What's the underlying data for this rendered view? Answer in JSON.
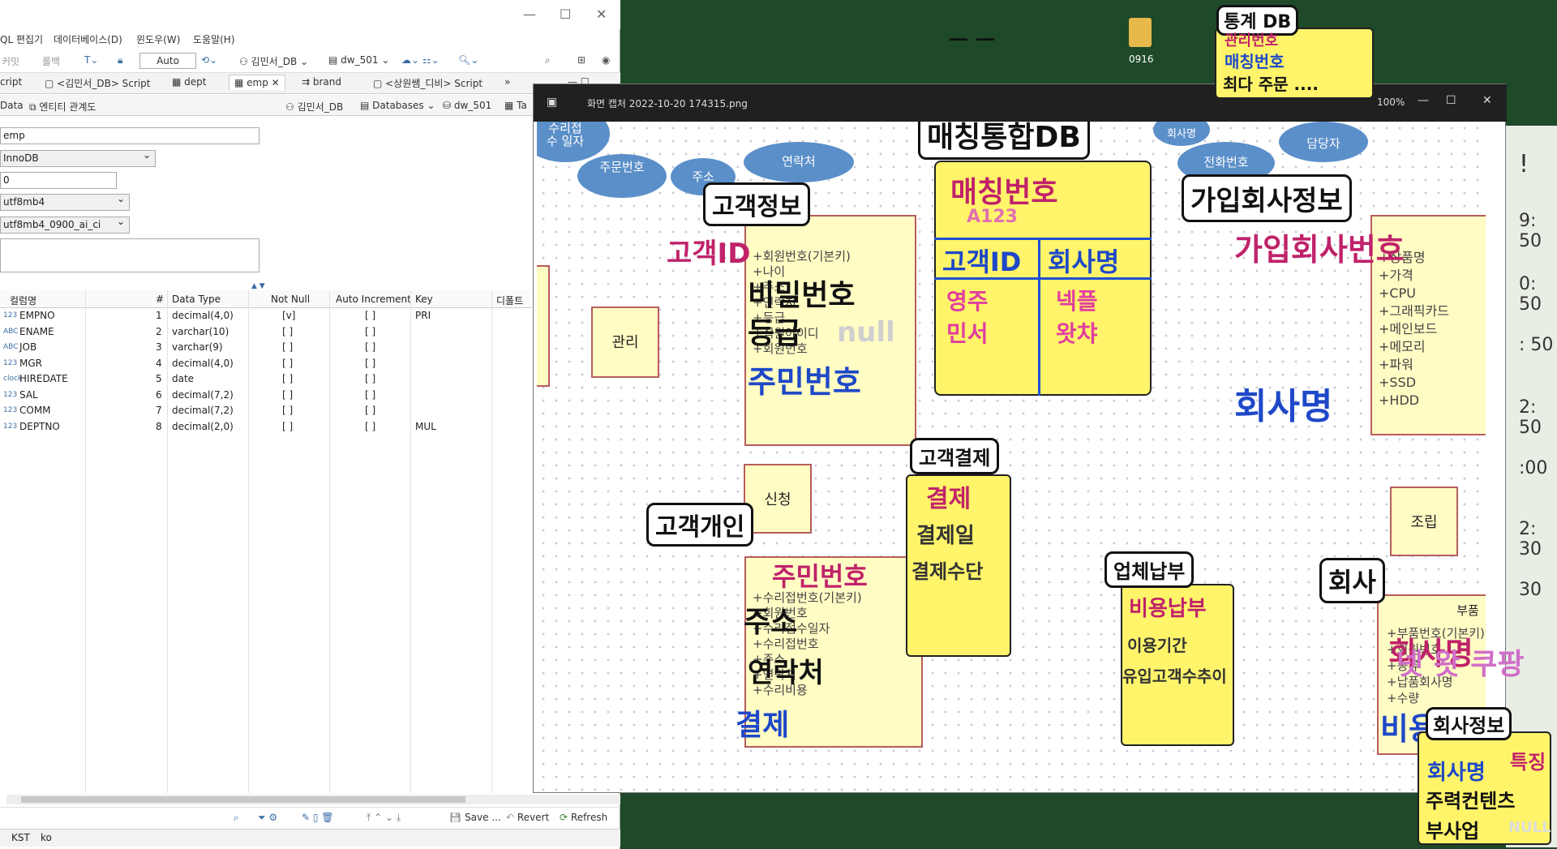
{
  "left_window": {
    "menu": [
      "QL 편집기",
      "데이터베이스(D)",
      "윈도우(W)",
      "도움말(H)"
    ],
    "toolbar": {
      "commit": "커밋",
      "rollback": "롤백",
      "auto": "Auto",
      "connection": "김민서_DB",
      "database": "dw_501"
    },
    "tabs": [
      "cript",
      "<김민서_DB> Script",
      "dept",
      "emp",
      "brand",
      "<상원쌤_디비> Script"
    ],
    "subtabs": [
      "Data",
      "엔티티 관계도",
      "김민서_DB",
      "Databases",
      "dw_501",
      "Ta"
    ],
    "props": {
      "name": "emp",
      "engine": "InnoDB",
      "auto_increment": "0",
      "charset": "utf8mb4",
      "collation": "utf8mb4_0900_ai_ci"
    },
    "columns_header": [
      "컬럼명",
      "#",
      "Data Type",
      "Not Null",
      "Auto Increment",
      "Key",
      "디폴트"
    ],
    "columns": [
      {
        "icon": "123",
        "name": "EMPNO",
        "num": "1",
        "type": "decimal(4,0)",
        "notnull": "[v]",
        "ai": "[ ]",
        "key": "PRI"
      },
      {
        "icon": "ABC",
        "name": "ENAME",
        "num": "2",
        "type": "varchar(10)",
        "notnull": "[ ]",
        "ai": "[ ]",
        "key": ""
      },
      {
        "icon": "ABC",
        "name": "JOB",
        "num": "3",
        "type": "varchar(9)",
        "notnull": "[ ]",
        "ai": "[ ]",
        "key": ""
      },
      {
        "icon": "123",
        "name": "MGR",
        "num": "4",
        "type": "decimal(4,0)",
        "notnull": "[ ]",
        "ai": "[ ]",
        "key": ""
      },
      {
        "icon": "clock",
        "name": "HIREDATE",
        "num": "5",
        "type": "date",
        "notnull": "[ ]",
        "ai": "[ ]",
        "key": ""
      },
      {
        "icon": "123",
        "name": "SAL",
        "num": "6",
        "type": "decimal(7,2)",
        "notnull": "[ ]",
        "ai": "[ ]",
        "key": ""
      },
      {
        "icon": "123",
        "name": "COMM",
        "num": "7",
        "type": "decimal(7,2)",
        "notnull": "[ ]",
        "ai": "[ ]",
        "key": ""
      },
      {
        "icon": "123",
        "name": "DEPTNO",
        "num": "8",
        "type": "decimal(2,0)",
        "notnull": "[ ]",
        "ai": "[ ]",
        "key": "MUL"
      }
    ],
    "bottom": {
      "save": "Save ...",
      "revert": "Revert",
      "refresh": "Refresh"
    },
    "status": [
      "KST",
      "ko"
    ]
  },
  "desktop": {
    "folder_label": "0916"
  },
  "viewer": {
    "title": "화면 캡처 2022-10-20 174315.png",
    "zoom": "100%"
  },
  "erd": {
    "ellipses": [
      "주문번호",
      "주소",
      "연락처",
      "전화번호",
      "담당자",
      "회사명"
    ],
    "top_left_text": [
      "수리접",
      "수 일자"
    ],
    "boxes": {
      "manage": "관리",
      "apply": "신청",
      "assemble": "조립",
      "part": "부품",
      "customer_lines": [
        "+회원번호(기본키)",
        "+나이",
        "+주소",
        "+연락처",
        "+등급",
        "+직원아이디",
        "+회원번호"
      ],
      "personal_lines": [
        "+수리접번호(기본키)",
        "+회원번호",
        "+수리접수일자",
        "+수리접번호",
        "+주소",
        "+연락처",
        "+수리비용"
      ],
      "company_lines": [
        "+상품명",
        "+가격",
        "+CPU",
        "+그래픽카드",
        "+메인보드",
        "+메모리",
        "+파워",
        "+SSD",
        "+HDD"
      ],
      "part_lines": [
        "+부품번호(기본키)",
        "+회원번호",
        "+종류",
        "+납품회사명",
        "+수량"
      ]
    }
  },
  "handwriting": {
    "top_dash": "ㅡ ㅡ",
    "tonggye_title": "통계 DB",
    "tonggye_lines": [
      "관리번호",
      "매칭번호",
      "최다 주문 ...."
    ],
    "matching_title": "매칭통합DB",
    "matching_key": "매칭번호",
    "matching_sample": "A123",
    "matching_cols": [
      "고객ID",
      "회사명"
    ],
    "matching_rows": [
      [
        "영주",
        "넥플"
      ],
      [
        "민서",
        "왓챠"
      ]
    ],
    "customer_title": "고객정보",
    "customer_id": "고객ID",
    "customer_pw": "비밀번호",
    "customer_grade": "등급",
    "customer_null": "null",
    "customer_resident": "주민번호",
    "company_title": "가입회사정보",
    "company_key": "가입회사번호",
    "company_name": "회사명",
    "payment_title": "고객결제",
    "payment_key": "결제",
    "payment_lines": [
      "결제일",
      "결제수단"
    ],
    "personal_title": "고객개인",
    "personal_key": "주민번호",
    "personal_addr": "주소",
    "personal_contact": "연락처",
    "personal_pay": "결제",
    "vendor_title": "업체납부",
    "vendor_key": "비용납부",
    "vendor_lines": [
      "이용기간",
      "유입고객수추이"
    ],
    "company2_title": "회사",
    "company2_name": "회사명",
    "company2_examples": "넷 왓 쿠팡",
    "company2_fee": "비용납부",
    "corp_title": "회사정보",
    "corp_lines": [
      "회사명",
      "주력컨텐츠",
      "부사업"
    ],
    "corp_extra": "특징",
    "corp_null": "NULL"
  },
  "side_panel": [
    "!",
    "9: 50",
    "0: 50",
    ": 50",
    "2: 50",
    ":00",
    "2: 30",
    "30"
  ]
}
